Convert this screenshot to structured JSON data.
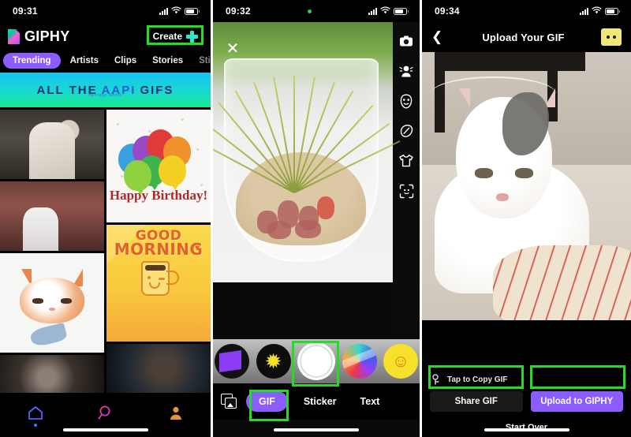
{
  "panel1": {
    "name": "giphy-home-screen",
    "status": {
      "time": "09:31",
      "signal_icon": "cellular-signal-icon",
      "wifi_icon": "wifi-icon",
      "battery_icon": "battery-icon"
    },
    "brand": {
      "logo_icon": "giphy-logo-icon",
      "name": "GIPHY"
    },
    "create": {
      "label": "Create",
      "icon": "plus-icon",
      "highlighted": true
    },
    "tabs": [
      {
        "label": "Trending",
        "active": true
      },
      {
        "label": "Artists",
        "active": false
      },
      {
        "label": "Clips",
        "active": false
      },
      {
        "label": "Stories",
        "active": false
      },
      {
        "label": "Sticker",
        "active": false
      }
    ],
    "banner": {
      "text_before": "ALL THE",
      "highlight": "AAPI",
      "text_after": "GIFS",
      "subtitle": "Heritage Month"
    },
    "gifs": [
      {
        "name": "two-men-talking-gif"
      },
      {
        "name": "basketball-player-gif"
      },
      {
        "name": "drawn-cat-gif"
      },
      {
        "name": "dark-scene-gif-a"
      },
      {
        "name": "happy-birthday-balloons-gif",
        "text_line1": "Happy",
        "text_line2": "Birthday!"
      },
      {
        "name": "good-morning-coffee-gif",
        "text_line1": "GOOD",
        "text_line2": "MORNING"
      },
      {
        "name": "dark-scene-gif-b"
      }
    ],
    "bottom_nav": [
      {
        "name": "home-icon",
        "label": "Home",
        "active": true
      },
      {
        "name": "search-icon",
        "label": "Search",
        "active": false
      },
      {
        "name": "profile-icon",
        "label": "Profile",
        "active": false
      }
    ]
  },
  "panel2": {
    "name": "giphy-camera-screen",
    "status": {
      "time": "09:32",
      "recording_dot": true,
      "signal_icon": "cellular-signal-icon",
      "wifi_icon": "wifi-icon",
      "battery_icon": "battery-icon"
    },
    "close": {
      "icon": "close-icon",
      "label": "Close"
    },
    "subject": "glass-terrarium-with-air-plant",
    "rail": [
      {
        "name": "camera-flip-icon"
      },
      {
        "name": "portrait-filter-icon"
      },
      {
        "name": "face-mask-icon"
      },
      {
        "name": "draw-pen-icon"
      },
      {
        "name": "tshirt-sticker-icon"
      },
      {
        "name": "face-scan-icon"
      }
    ],
    "filters": [
      {
        "name": "purple-shape-filter"
      },
      {
        "name": "starburst-filter",
        "glyph": "✹"
      },
      {
        "name": "shutter-button",
        "highlighted": true
      },
      {
        "name": "rainbow-swirl-filter"
      },
      {
        "name": "smiley-filter",
        "glyph": "☺"
      }
    ],
    "modes": {
      "gallery_icon": "gallery-icon",
      "items": [
        {
          "label": "GIF",
          "active": true,
          "highlighted": true
        },
        {
          "label": "Sticker",
          "active": false,
          "highlighted": false
        },
        {
          "label": "Text",
          "active": false,
          "highlighted": false
        }
      ]
    }
  },
  "panel3": {
    "name": "upload-your-gif-screen",
    "status": {
      "time": "09:34",
      "signal_icon": "cellular-signal-icon",
      "wifi_icon": "wifi-icon",
      "battery_icon": "battery-icon"
    },
    "header": {
      "back_icon": "back-chevron-icon",
      "title": "Upload Your GIF",
      "more_icon": "more-options-icon"
    },
    "preview": {
      "subject": "white-and-grey-cat-on-striped-towel"
    },
    "copy_hint": {
      "icon": "link-icon",
      "label": "Tap to Copy GIF"
    },
    "actions": [
      {
        "label": "Share GIF",
        "style": "dark",
        "highlighted": true
      },
      {
        "label": "Upload to GIPHY",
        "style": "purple",
        "highlighted": true
      }
    ],
    "start_over": "Start Over"
  },
  "colors": {
    "giphy_purple": "#8b5cff",
    "annotation_green": "#22dd22",
    "create_plus_teal": "#2ee6c8",
    "banner_start": "#17c3f0",
    "banner_end": "#19e88e",
    "upload_yellow": "#efe87a"
  }
}
